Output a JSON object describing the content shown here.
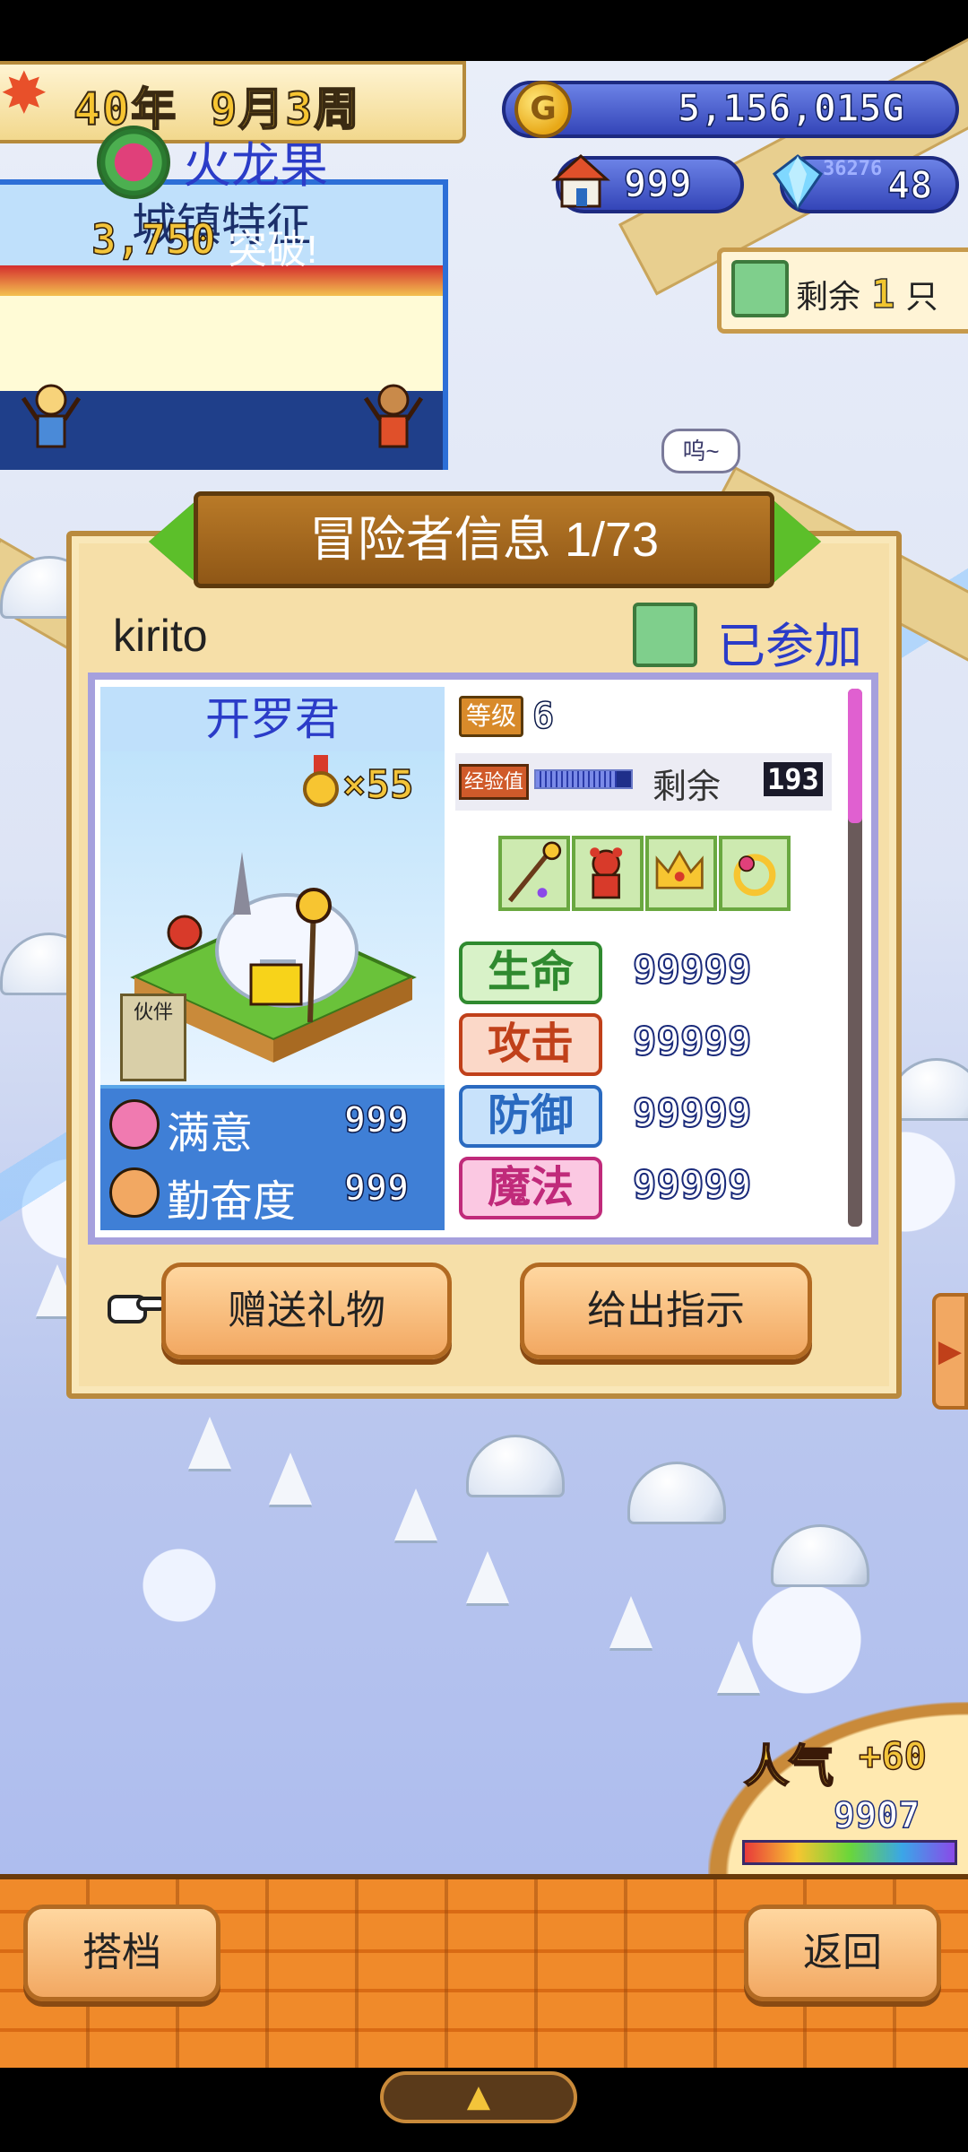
{
  "header": {
    "year": "40年",
    "month_week": "9月3周",
    "gold": "5,156,015G",
    "houses": "999",
    "crystals": "48",
    "crystal_small": "36276"
  },
  "remaining": {
    "label": "剩余",
    "count": "1",
    "unit": "只"
  },
  "town_feature": {
    "title": "城镇特征",
    "item": "火龙果",
    "break_count": "3,750",
    "break_label": "突破!"
  },
  "speech_bubble": "呜~",
  "adventurer_panel": {
    "title": "冒险者信息 1/73",
    "name": "kirito",
    "status": "已参加",
    "class_name": "开罗君",
    "medal_count": "×55",
    "partner_tag": "伙伴",
    "satisfaction_label": "满意",
    "satisfaction_value": "999",
    "diligence_label": "勤奋度",
    "diligence_value": "999",
    "level_label": "等级",
    "level_value": "6",
    "exp_label": "经验值",
    "exp_progress": 0.85,
    "exp_remain_label": "剩余",
    "exp_remain_value": "193",
    "equipment": [
      "staff-icon",
      "bear-icon",
      "crown-icon",
      "ring-icon"
    ],
    "attributes": [
      {
        "label": "生命",
        "value": "99999",
        "color": "#2f8a2f"
      },
      {
        "label": "攻击",
        "value": "99999",
        "color": "#c0401a"
      },
      {
        "label": "防御",
        "value": "99999",
        "color": "#2a6ac0"
      },
      {
        "label": "魔法",
        "value": "99999",
        "color": "#c02a7a"
      }
    ]
  },
  "actions": {
    "gift": "赠送礼物",
    "instruct": "给出指示"
  },
  "popularity": {
    "label": "人气",
    "delta": "+60",
    "value": "9907"
  },
  "bottom": {
    "partner": "搭档",
    "back": "返回"
  },
  "colors": {
    "accent_blue": "#2b3cc8",
    "panel": "#f6dfa8",
    "button_orange": "#f2a862"
  }
}
